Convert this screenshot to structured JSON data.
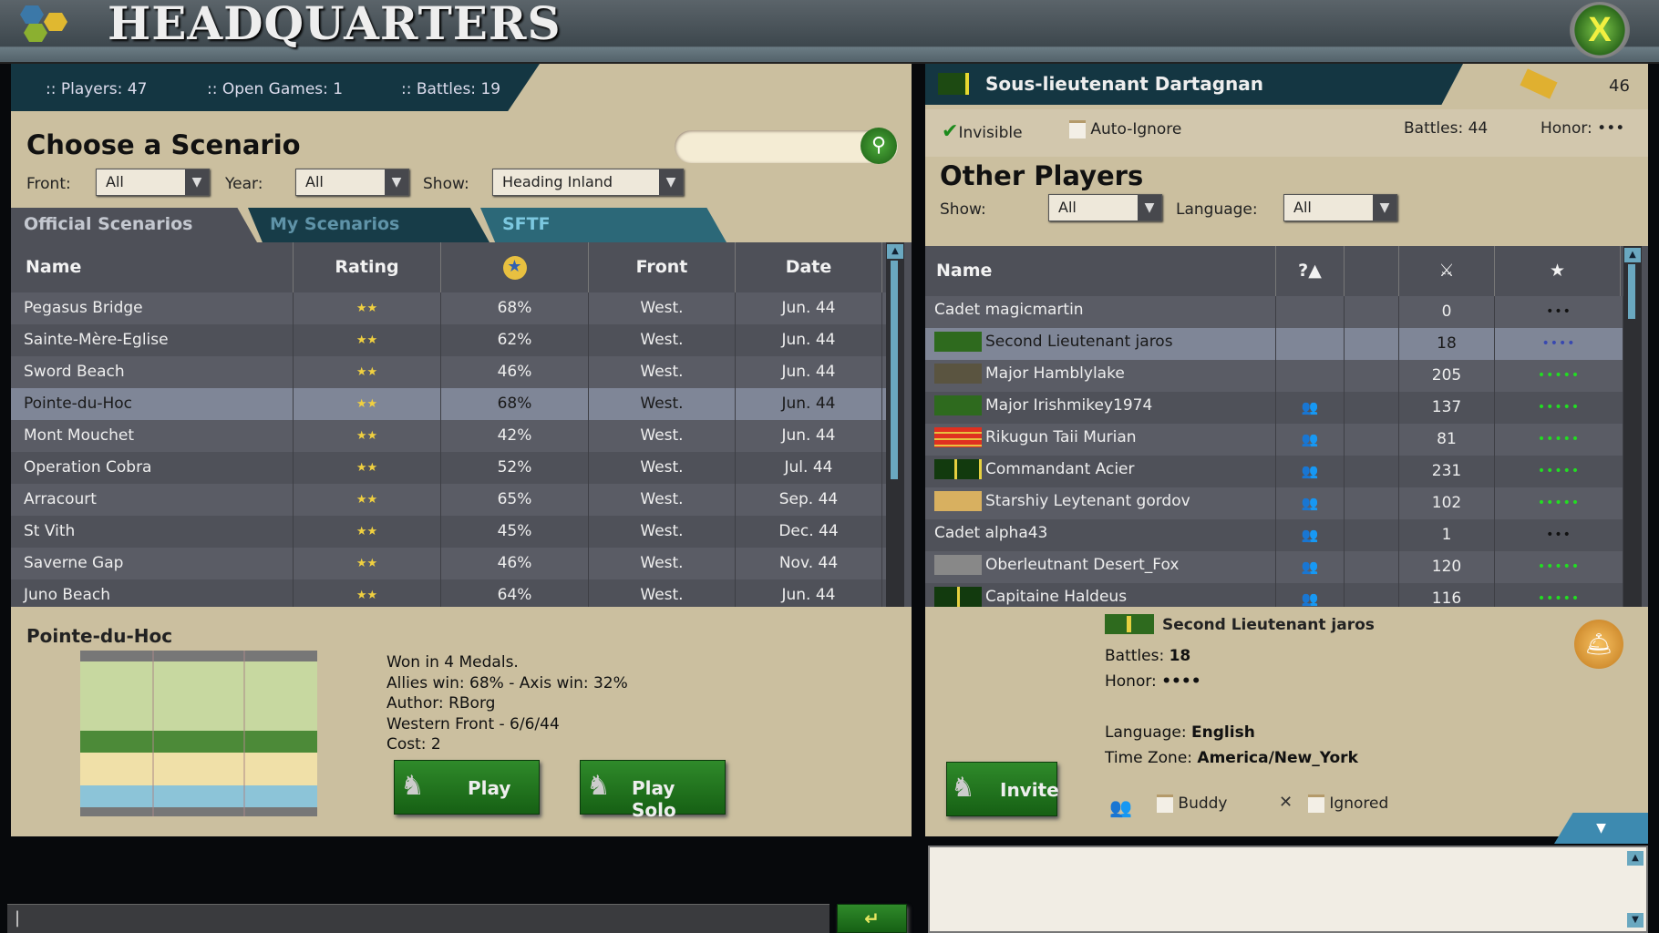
{
  "header": {
    "title": "HEADQUARTERS",
    "close_label": "X"
  },
  "stats": {
    "players": ":: Players: 47",
    "open_games": ":: Open Games: 1",
    "battles": ":: Battles: 19"
  },
  "scenarios": {
    "title": "Choose a Scenario",
    "search_placeholder": "",
    "filters": {
      "front_label": "Front:",
      "front_value": "All",
      "year_label": "Year:",
      "year_value": "All",
      "show_label": "Show:",
      "show_value": "Heading Inland"
    },
    "tabs": [
      {
        "label": "Official Scenarios",
        "active": true
      },
      {
        "label": "My Scenarios"
      },
      {
        "label": "SFTF"
      }
    ],
    "columns": [
      "Name",
      "Rating",
      "star-medal-icon",
      "Front",
      "Date"
    ],
    "rows": [
      {
        "name": "Pegasus Bridge",
        "rating": "★★",
        "pct": "68%",
        "front": "West.",
        "date": "Jun. 44"
      },
      {
        "name": "Sainte-Mère-Eglise",
        "rating": "★★",
        "pct": "62%",
        "front": "West.",
        "date": "Jun. 44"
      },
      {
        "name": "Sword Beach",
        "rating": "★★",
        "pct": "46%",
        "front": "West.",
        "date": "Jun. 44"
      },
      {
        "name": "Pointe-du-Hoc",
        "rating": "★★",
        "pct": "68%",
        "front": "West.",
        "date": "Jun. 44",
        "selected": true
      },
      {
        "name": "Mont Mouchet",
        "rating": "★★",
        "pct": "42%",
        "front": "West.",
        "date": "Jun. 44"
      },
      {
        "name": "Operation Cobra",
        "rating": "★★",
        "pct": "52%",
        "front": "West.",
        "date": "Jul. 44"
      },
      {
        "name": "Arracourt",
        "rating": "★★",
        "pct": "65%",
        "front": "West.",
        "date": "Sep. 44"
      },
      {
        "name": "St Vith",
        "rating": "★★",
        "pct": "45%",
        "front": "West.",
        "date": "Dec. 44"
      },
      {
        "name": "Saverne Gap",
        "rating": "★★",
        "pct": "46%",
        "front": "West.",
        "date": "Nov. 44"
      },
      {
        "name": "Juno Beach",
        "rating": "★★",
        "pct": "64%",
        "front": "West.",
        "date": "Jun. 44"
      }
    ],
    "detail": {
      "title": "Pointe-du-Hoc",
      "lines": [
        "Won in 4 Medals.",
        "Allies win: 68% - Axis win: 32%",
        "Author: RBorg",
        "Western Front - 6/6/44",
        "Cost: 2"
      ],
      "play_label": "Play",
      "play_solo_label": "Play Solo"
    }
  },
  "chat": {
    "input_value": "",
    "send_icon": "enter-icon"
  },
  "profile": {
    "name": "Sous-lieutenant Dartagnan",
    "gold": "46",
    "invisible_label": "Invisible",
    "invisible_checked": true,
    "auto_ignore_label": "Auto-Ignore",
    "auto_ignore_checked": false,
    "battles": "Battles: 44",
    "honor": "Honor: •••"
  },
  "players": {
    "title": "Other Players",
    "show_label": "Show:",
    "show_value": "All",
    "language_label": "Language:",
    "language_value": "All",
    "columns": [
      "Name",
      "?▲",
      "",
      "crossed-swords-icon",
      "star-icon"
    ],
    "rows": [
      {
        "name": "Cadet magicmartin",
        "rank": "none",
        "buddy": false,
        "battles": "0",
        "honor": "•••",
        "honor_color": "#111111"
      },
      {
        "name": "Second Lieutenant jaros",
        "rank": "us-2lt",
        "buddy": false,
        "battles": "18",
        "honor": "••••",
        "honor_color": "#3848b0",
        "selected": true
      },
      {
        "name": "Major Hamblylake",
        "rank": "uk-major",
        "buddy": false,
        "battles": "205",
        "honor": "•••••",
        "honor_color": "#22dd22"
      },
      {
        "name": "Major Irishmikey1974",
        "rank": "us-major",
        "buddy": true,
        "battles": "137",
        "honor": "•••••",
        "honor_color": "#22dd22"
      },
      {
        "name": "Rikugun Taii Murian",
        "rank": "jp-captain",
        "buddy": true,
        "battles": "81",
        "honor": "•••••",
        "honor_color": "#22dd22"
      },
      {
        "name": "Commandant Acier",
        "rank": "fr-commandant",
        "buddy": true,
        "battles": "231",
        "honor": "•••••",
        "honor_color": "#22dd22"
      },
      {
        "name": "Starshiy Leytenant gordov",
        "rank": "ru-senior-lt",
        "buddy": true,
        "battles": "102",
        "honor": "•••••",
        "honor_color": "#22dd22"
      },
      {
        "name": "Cadet alpha43",
        "rank": "none",
        "buddy": true,
        "battles": "1",
        "honor": "•••",
        "honor_color": "#111111"
      },
      {
        "name": "Oberleutnant Desert_Fox",
        "rank": "de-oberleutnant",
        "buddy": true,
        "battles": "120",
        "honor": "•••••",
        "honor_color": "#22dd22"
      },
      {
        "name": "Capitaine Haldeus",
        "rank": "fr-capitaine",
        "buddy": true,
        "battles": "116",
        "honor": "•••••",
        "honor_color": "#22dd22"
      }
    ],
    "detail": {
      "name": "Second Lieutenant jaros",
      "battles_label": "Battles: ",
      "battles_value": "18",
      "honor_label": "Honor: ",
      "honor_value": "••••",
      "language_label": "Language: ",
      "language_value": "English",
      "tz_label": "Time Zone: ",
      "tz_value": "America/New_York",
      "invite_label": "Invite",
      "buddy_label": "Buddy",
      "ignored_label": "Ignored"
    }
  },
  "colors": {
    "teal": "#143642",
    "table": "#4f5159",
    "selected": "#7f8697",
    "green": "#1f7a1c",
    "parchment": "#cbbf9f"
  }
}
